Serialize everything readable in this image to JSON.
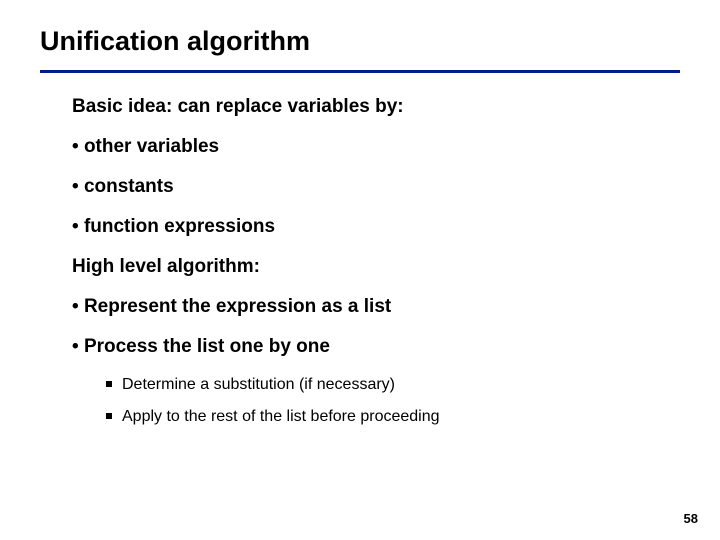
{
  "slide": {
    "title": "Unification algorithm",
    "intro": "Basic idea: can replace variables by:",
    "b1": "other variables",
    "b2": "constants",
    "b3": "function expressions",
    "hl": "High level algorithm:",
    "b4": "Represent the expression as a list",
    "b5": "Process the list one by one",
    "s1": "Determine a substitution (if necessary)",
    "s2": "Apply to the rest of the list before proceeding",
    "page": "58"
  }
}
